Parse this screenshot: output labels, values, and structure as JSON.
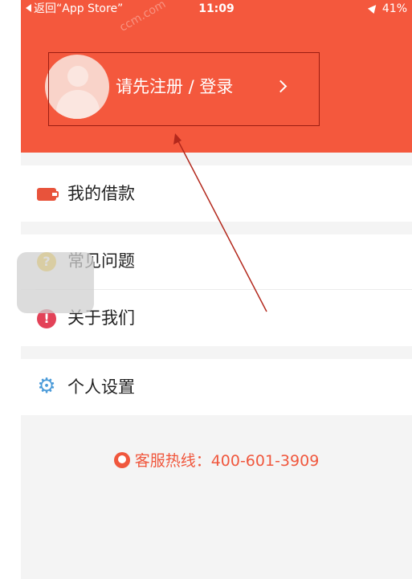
{
  "status_bar": {
    "back_label": "返回“App Store”",
    "time": "11:09",
    "battery": "41%"
  },
  "header": {
    "login_prompt": "请先注册 / 登录",
    "watermark": "ccm.com"
  },
  "menu": {
    "items": [
      {
        "label": "我的借款",
        "icon": "wallet-icon"
      },
      {
        "label": "常见问题",
        "icon": "question-icon"
      },
      {
        "label": "关于我们",
        "icon": "alert-icon"
      },
      {
        "label": "个人设置",
        "icon": "gear-icon"
      }
    ]
  },
  "footer": {
    "hotline": "客服热线：400-601-3909"
  },
  "colors": {
    "brand": "#f4583d",
    "background": "#f4f4f4",
    "gear": "#4b9bd9",
    "question": "#f3c11d",
    "alert": "#e34258"
  }
}
